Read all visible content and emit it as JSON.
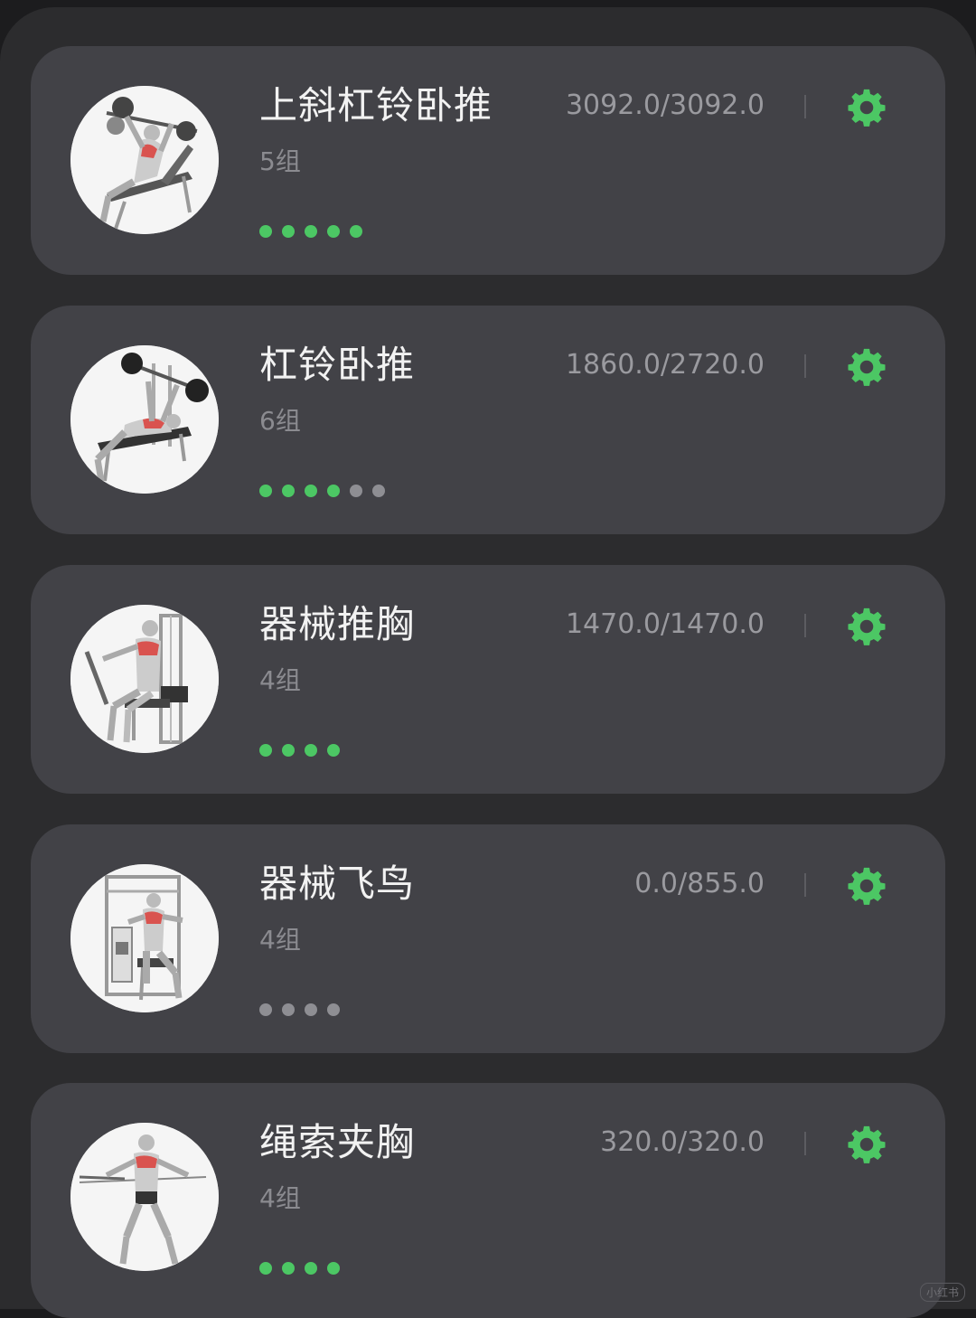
{
  "colors": {
    "accent": "#4cc764",
    "dot_done": "#4cc764",
    "dot_pending": "#8e8e93"
  },
  "exercises": [
    {
      "title": "上斜杠铃卧推",
      "sets": "5组",
      "volume": "3092.0/3092.0",
      "sets_total": 5,
      "sets_done": 5,
      "thumb_icon": "incline-bench-press-illustration",
      "settings_icon": "gear-icon"
    },
    {
      "title": "杠铃卧推",
      "sets": "6组",
      "volume": "1860.0/2720.0",
      "sets_total": 6,
      "sets_done": 4,
      "thumb_icon": "bench-press-illustration",
      "settings_icon": "gear-icon"
    },
    {
      "title": "器械推胸",
      "sets": "4组",
      "volume": "1470.0/1470.0",
      "sets_total": 4,
      "sets_done": 4,
      "thumb_icon": "machine-chest-press-illustration",
      "settings_icon": "gear-icon"
    },
    {
      "title": "器械飞鸟",
      "sets": "4组",
      "volume": "0.0/855.0",
      "sets_total": 4,
      "sets_done": 0,
      "thumb_icon": "machine-fly-illustration",
      "settings_icon": "gear-icon"
    },
    {
      "title": "绳索夹胸",
      "sets": "4组",
      "volume": "320.0/320.0",
      "sets_total": 4,
      "sets_done": 4,
      "thumb_icon": "cable-crossover-illustration",
      "settings_icon": "gear-icon"
    }
  ],
  "watermark": "小红书"
}
